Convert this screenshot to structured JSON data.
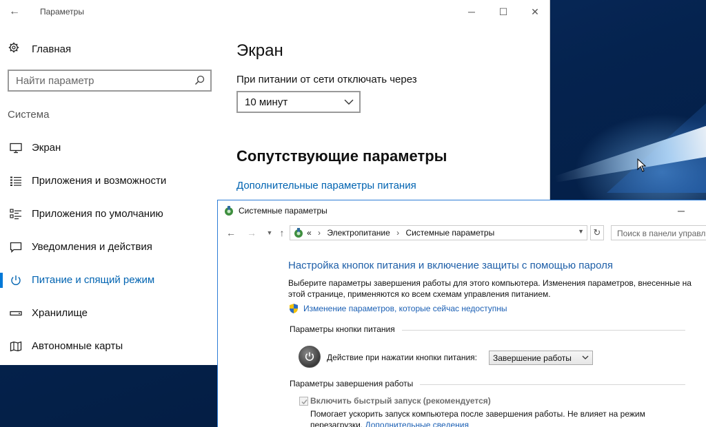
{
  "colors": {
    "accent": "#0078d7",
    "link": "#0063b1",
    "cp_heading": "#1e5fa8",
    "desktop": "#06224a"
  },
  "settings": {
    "title": "Параметры",
    "home_label": "Главная",
    "search_placeholder": "Найти параметр",
    "section_label": "Система",
    "nav_items": [
      {
        "label": "Экран",
        "icon": "monitor-icon",
        "active": false
      },
      {
        "label": "Приложения и возможности",
        "icon": "list-icon",
        "active": false
      },
      {
        "label": "Приложения по умолчанию",
        "icon": "default-apps-icon",
        "active": false
      },
      {
        "label": "Уведомления и действия",
        "icon": "notification-icon",
        "active": false
      },
      {
        "label": "Питание и спящий режим",
        "icon": "power-icon",
        "active": true
      },
      {
        "label": "Хранилище",
        "icon": "storage-icon",
        "active": false
      },
      {
        "label": "Автономные карты",
        "icon": "map-icon",
        "active": false
      }
    ],
    "content": {
      "page_title": "Экран",
      "power_label": "При питании от сети отключать через",
      "timeout_value": "10 минут",
      "related_heading": "Сопутствующие параметры",
      "power_link": "Дополнительные параметры питания"
    }
  },
  "control_panel": {
    "title": "Системные параметры",
    "breadcrumb_prefix": "«",
    "breadcrumb": [
      "Электропитание",
      "Системные параметры"
    ],
    "search_placeholder": "Поиск в панели управл",
    "heading": "Настройка кнопок питания и включение защиты с помощью пароля",
    "description": "Выберите параметры завершения работы для этого компьютера. Изменения параметров, внесенные на этой странице, применяются ко всем схемам управления питанием.",
    "change_link": "Изменение параметров, которые сейчас недоступны",
    "power_button_group": "Параметры кнопки питания",
    "action_label": "Действие при нажатии кнопки питания:",
    "action_value": "Завершение работы",
    "shutdown_group": "Параметры завершения работы",
    "fast_startup_label": "Включить быстрый запуск (рекомендуется)",
    "fast_startup_checked": true,
    "fast_startup_desc": "Помогает ускорить запуск компьютера после завершения работы. Не влияет на режим перезагрузки.",
    "more_info_link": "Дополнительные сведения"
  }
}
